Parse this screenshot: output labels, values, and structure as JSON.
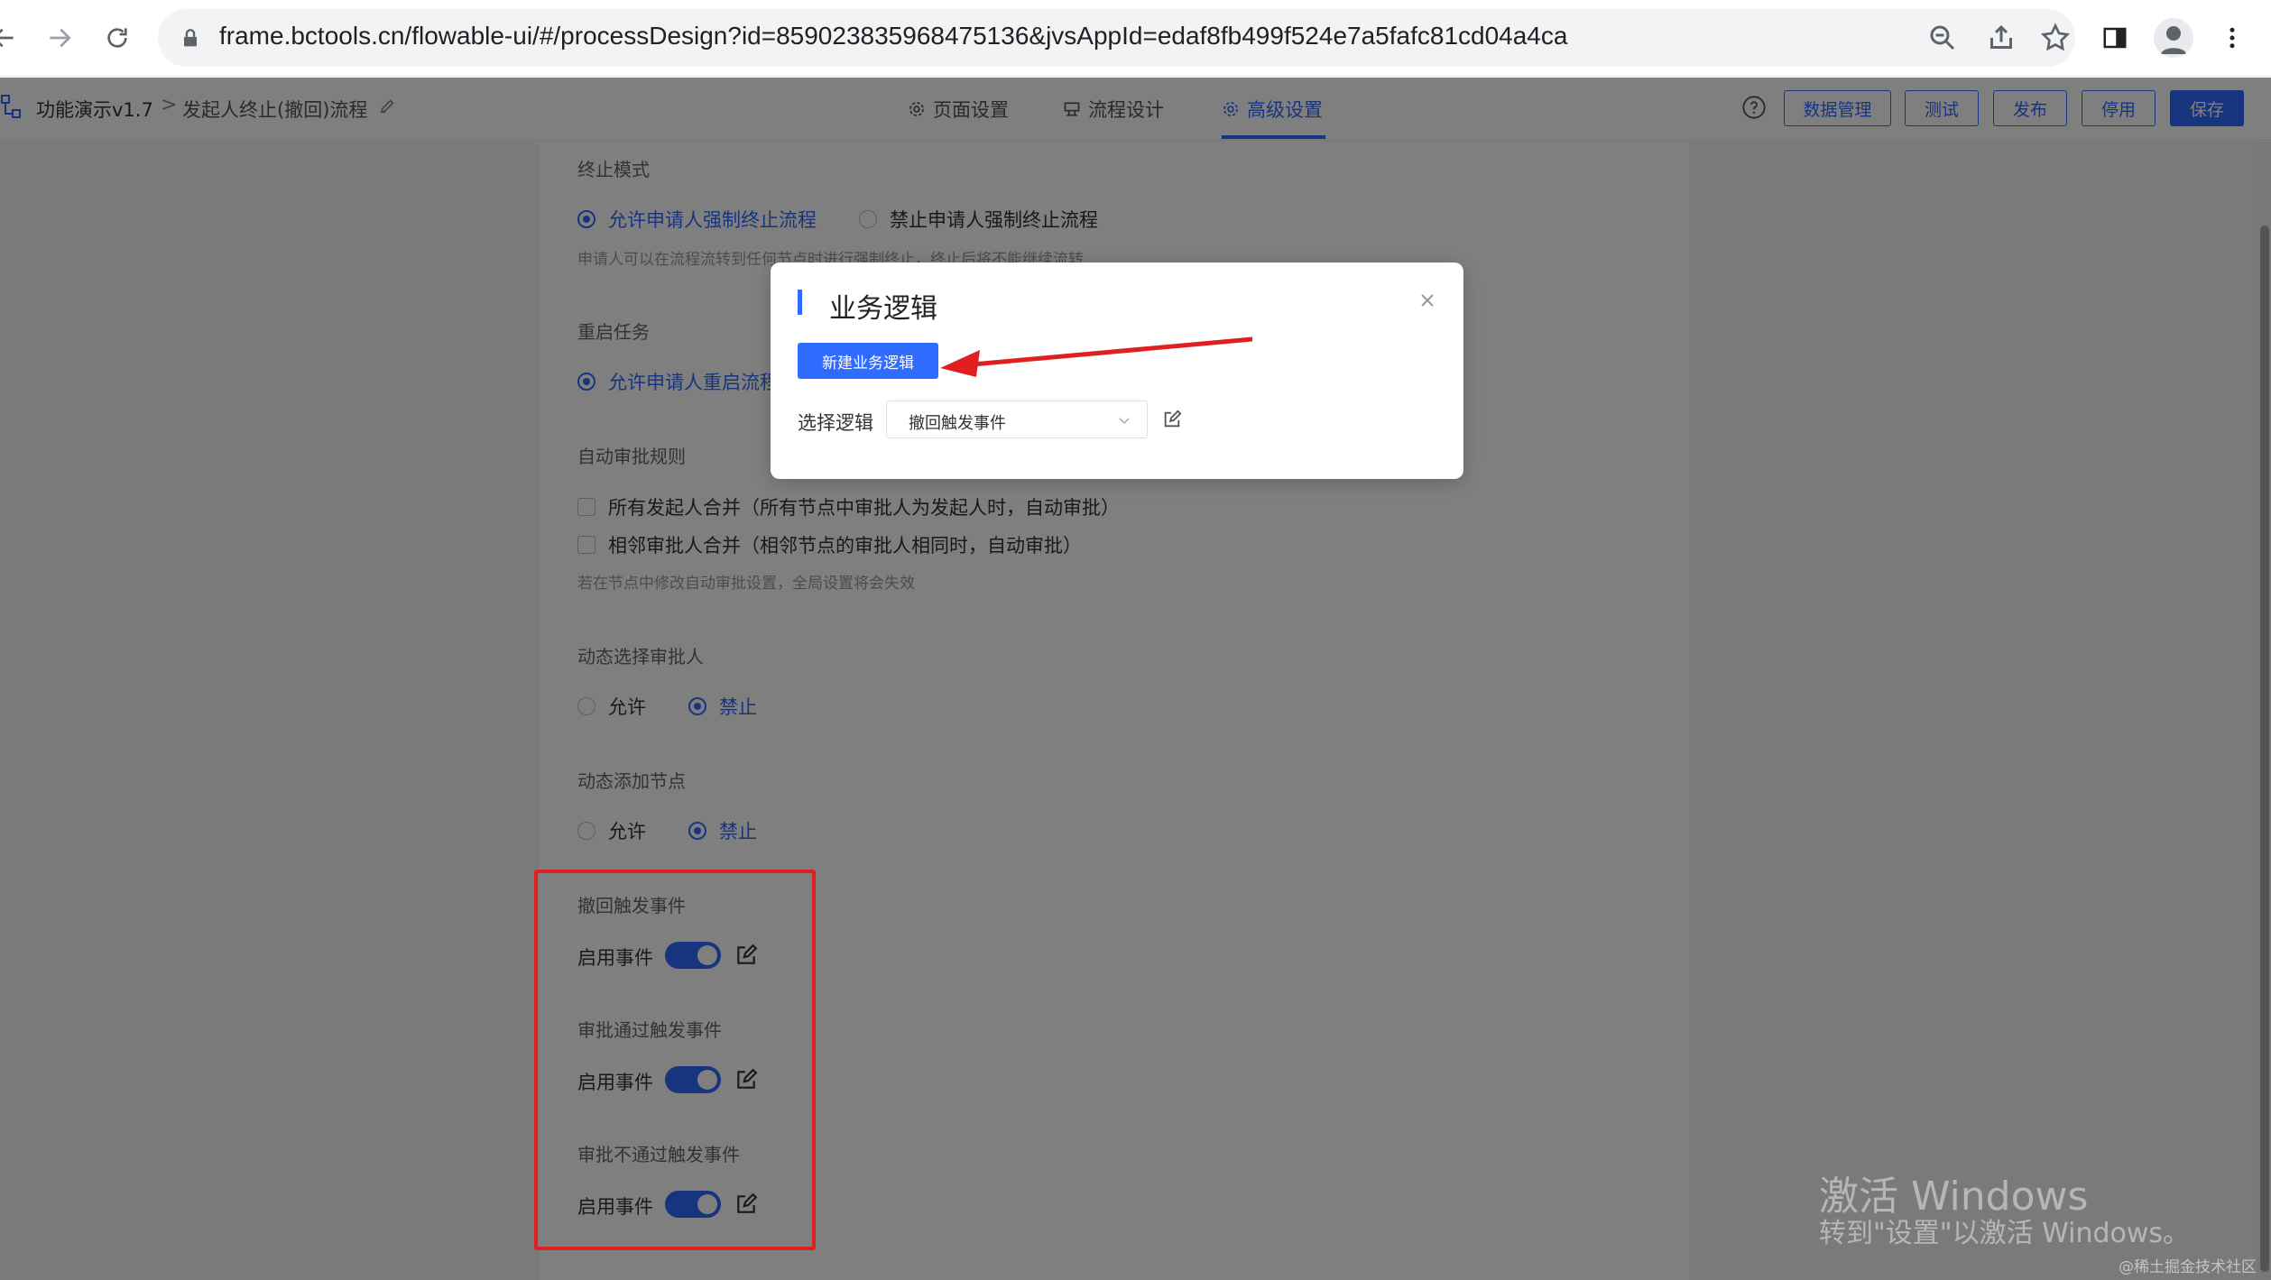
{
  "browser": {
    "url": "frame.bctools.cn/flowable-ui/#/processDesign?id=859023835968475136&jvsAppId=edaf8fb499f524e7a5fafc81cd04a4ca"
  },
  "header": {
    "app_name": "功能演示v1.7",
    "separator": ">",
    "flow_name": "发起人终止(撤回)流程",
    "tabs": [
      {
        "label": "页面设置"
      },
      {
        "label": "流程设计"
      },
      {
        "label": "高级设置"
      }
    ],
    "buttons": {
      "data_manage": "数据管理",
      "test": "测试",
      "publish": "发布",
      "disable": "停用",
      "save": "保存"
    }
  },
  "settings": {
    "terminate": {
      "title": "终止模式",
      "opt_allow": "允许申请人强制终止流程",
      "opt_forbid": "禁止申请人强制终止流程",
      "hint": "申请人可以在流程流转到任何节点时进行强制终止，终止后将不能继续流转"
    },
    "restart": {
      "title": "重启任务",
      "opt_allow": "允许申请人重启流程"
    },
    "auto_approve": {
      "title": "自动审批规则",
      "opt1": "所有发起人合并（所有节点中审批人为发起人时，自动审批）",
      "opt2": "相邻审批人合并（相邻节点的审批人相同时，自动审批）",
      "hint": "若在节点中修改自动审批设置，全局设置将会失效"
    },
    "dynamic_approver": {
      "title": "动态选择审批人",
      "allow": "允许",
      "forbid": "禁止"
    },
    "dynamic_node": {
      "title": "动态添加节点",
      "allow": "允许",
      "forbid": "禁止"
    },
    "events": [
      {
        "title": "撤回触发事件",
        "label": "启用事件",
        "enabled": true
      },
      {
        "title": "审批通过触发事件",
        "label": "启用事件",
        "enabled": true
      },
      {
        "title": "审批不通过触发事件",
        "label": "启用事件",
        "enabled": true
      }
    ]
  },
  "dialog": {
    "title": "业务逻辑",
    "new_button": "新建业务逻辑",
    "select_label": "选择逻辑",
    "select_value": "撤回触发事件"
  },
  "watermark": {
    "line1": "激活 Windows",
    "line2": "转到\"设置\"以激活 Windows。",
    "credit": "@稀土掘金技术社区"
  },
  "colors": {
    "accent": "#2f6bff",
    "highlight_box": "#e02020",
    "annotation_arrow": "#e02020"
  }
}
